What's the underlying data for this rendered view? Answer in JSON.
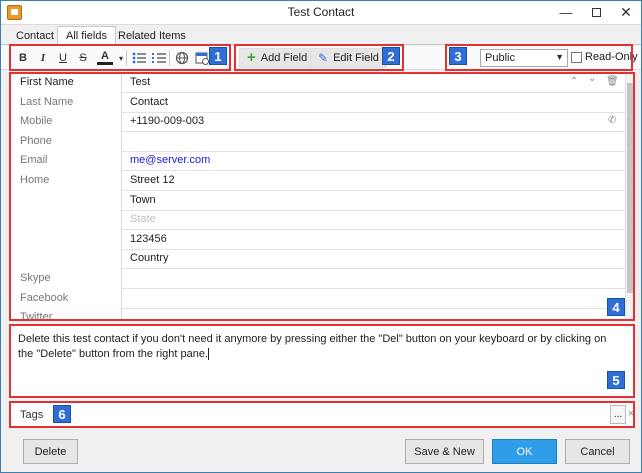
{
  "window": {
    "title": "Test Contact"
  },
  "tabs": [
    {
      "label": "Contact"
    },
    {
      "label": "All fields"
    },
    {
      "label": "Related Items"
    }
  ],
  "toolbar": {
    "format_icons": [
      "bold-icon",
      "italic-icon",
      "underline-icon",
      "strikethrough-icon",
      "font-color-icon",
      "bullet-list-icon",
      "numbered-list-icon",
      "link-icon",
      "insert-date-icon"
    ],
    "bold_glyph": "B",
    "italic_glyph": "I",
    "underline_glyph": "U",
    "strike_glyph": "S",
    "fontcolor_glyph": "A",
    "add_field_label": "Add Field",
    "edit_field_label": "Edit Field",
    "visibility_value": "Public",
    "readonly_label": "Read-Only"
  },
  "fields": [
    {
      "label": "First Name",
      "value": "Test",
      "kind": "normal"
    },
    {
      "label": "Last Name",
      "value": "Contact",
      "kind": "normal"
    },
    {
      "label": "Mobile",
      "value": "+1190-009-003",
      "kind": "normal"
    },
    {
      "label": "Phone",
      "value": "",
      "kind": "normal"
    },
    {
      "label": "Email",
      "value": "me@server.com",
      "kind": "link"
    },
    {
      "label": "Home",
      "value": "Street 12",
      "kind": "normal"
    },
    {
      "label": "",
      "value": "Town",
      "kind": "normal"
    },
    {
      "label": "",
      "value": "State",
      "kind": "placeholder"
    },
    {
      "label": "",
      "value": "123456",
      "kind": "normal"
    },
    {
      "label": "",
      "value": "Country",
      "kind": "normal"
    },
    {
      "label": "Skype",
      "value": "",
      "kind": "normal"
    },
    {
      "label": "Facebook",
      "value": "",
      "kind": "normal"
    },
    {
      "label": "Twitter",
      "value": "",
      "kind": "normal"
    }
  ],
  "notes": {
    "text": "Delete this test contact if you don't need it anymore by pressing either the \"Del\" button on your keyboard or by clicking on the \"Delete\" button from the right pane."
  },
  "tags": {
    "label": "Tags",
    "more": "...",
    "clear": "×"
  },
  "buttons": {
    "delete": "Delete",
    "save_new": "Save & New",
    "ok": "OK",
    "cancel": "Cancel"
  },
  "callouts": [
    "1",
    "2",
    "3",
    "4",
    "5",
    "6"
  ],
  "colors": {
    "callout_border": "#e03232",
    "badge": "#2f6fd5",
    "ok_button": "#2f9de8"
  }
}
